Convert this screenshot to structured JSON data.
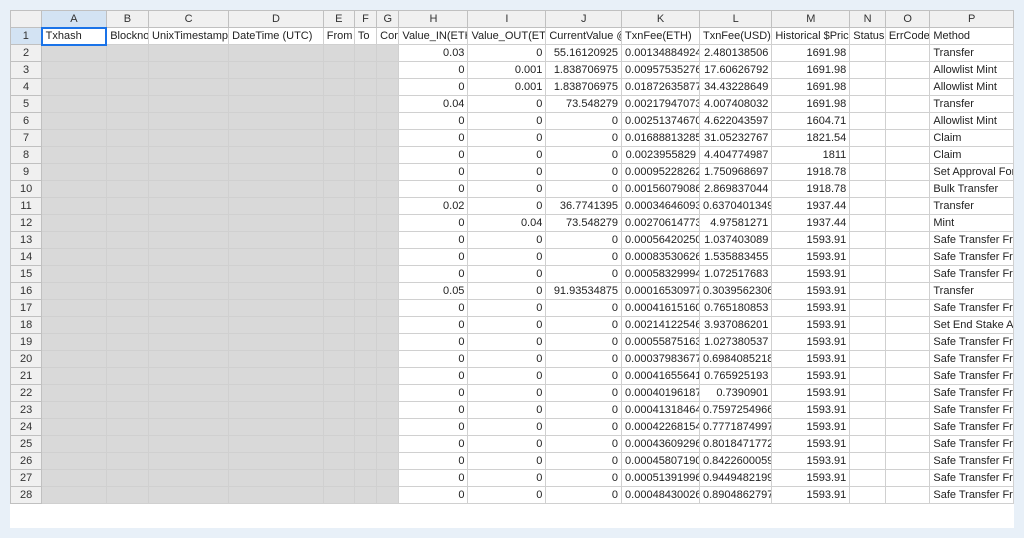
{
  "columns": [
    "A",
    "B",
    "C",
    "D",
    "E",
    "F",
    "G",
    "H",
    "I",
    "J",
    "K",
    "L",
    "M",
    "N",
    "O",
    "P"
  ],
  "headers": {
    "A": "Txhash",
    "B": "Blockno",
    "C": "UnixTimestamp",
    "D": "DateTime (UTC)",
    "E": "From",
    "F": "To",
    "G": "ContractAddress",
    "H": "Value_IN(ETH)",
    "I": "Value_OUT(ETH)",
    "J": "CurrentValue @ $",
    "K": "TxnFee(ETH)",
    "L": "TxnFee(USD)",
    "M": "Historical $Price",
    "N": "Status",
    "O": "ErrCode",
    "P": "Method"
  },
  "rows": [
    {
      "H": "0.03",
      "I": "0",
      "J": "55.16120925",
      "K": "0.00134884924",
      "L": "2.480138506",
      "M": "1691.98",
      "P": "Transfer"
    },
    {
      "H": "0",
      "I": "0.001",
      "J": "1.838706975",
      "K": "0.00957535276",
      "L": "17.60626792",
      "M": "1691.98",
      "P": "Allowlist Mint"
    },
    {
      "H": "0",
      "I": "0.001",
      "J": "1.838706975",
      "K": "0.01872635877",
      "L": "34.43228649",
      "M": "1691.98",
      "P": "Allowlist Mint"
    },
    {
      "H": "0.04",
      "I": "0",
      "J": "73.548279",
      "K": "0.00217947073",
      "L": "4.007408032",
      "M": "1691.98",
      "P": "Transfer"
    },
    {
      "H": "0",
      "I": "0",
      "J": "0",
      "K": "0.00251374670",
      "L": "4.622043597",
      "M": "1604.71",
      "P": "Allowlist Mint"
    },
    {
      "H": "0",
      "I": "0",
      "J": "0",
      "K": "0.01688813285",
      "L": "31.05232767",
      "M": "1821.54",
      "P": "Claim"
    },
    {
      "H": "0",
      "I": "0",
      "J": "0",
      "K": "0.0023955829",
      "L": "4.404774987",
      "M": "1811",
      "P": "Claim"
    },
    {
      "H": "0",
      "I": "0",
      "J": "0",
      "K": "0.00095228262",
      "L": "1.750968697",
      "M": "1918.78",
      "P": "Set Approval For All"
    },
    {
      "H": "0",
      "I": "0",
      "J": "0",
      "K": "0.00156079086",
      "L": "2.869837044",
      "M": "1918.78",
      "P": "Bulk Transfer"
    },
    {
      "H": "0.02",
      "I": "0",
      "J": "36.7741395",
      "K": "0.00034646093",
      "L": "0.6370401349",
      "M": "1937.44",
      "P": "Transfer"
    },
    {
      "H": "0",
      "I": "0.04",
      "J": "73.548279",
      "K": "0.00270614773",
      "L": "4.97581271",
      "M": "1937.44",
      "P": "Mint"
    },
    {
      "H": "0",
      "I": "0",
      "J": "0",
      "K": "0.00056420250",
      "L": "1.037403089",
      "M": "1593.91",
      "P": "Safe Transfer From"
    },
    {
      "H": "0",
      "I": "0",
      "J": "0",
      "K": "0.00083530626",
      "L": "1.535883455",
      "M": "1593.91",
      "P": "Safe Transfer From"
    },
    {
      "H": "0",
      "I": "0",
      "J": "0",
      "K": "0.00058329994",
      "L": "1.072517683",
      "M": "1593.91",
      "P": "Safe Transfer From"
    },
    {
      "H": "0.05",
      "I": "0",
      "J": "91.93534875",
      "K": "0.00016530977",
      "L": "0.3039562306",
      "M": "1593.91",
      "P": "Transfer"
    },
    {
      "H": "0",
      "I": "0",
      "J": "0",
      "K": "0.00041615160",
      "L": "0.765180853",
      "M": "1593.91",
      "P": "Safe Transfer From"
    },
    {
      "H": "0",
      "I": "0",
      "J": "0",
      "K": "0.00214122546",
      "L": "3.937086201",
      "M": "1593.91",
      "P": "Set End Stake Array"
    },
    {
      "H": "0",
      "I": "0",
      "J": "0",
      "K": "0.00055875163",
      "L": "1.027380537",
      "M": "1593.91",
      "P": "Safe Transfer From"
    },
    {
      "H": "0",
      "I": "0",
      "J": "0",
      "K": "0.00037983677",
      "L": "0.6984085218",
      "M": "1593.91",
      "P": "Safe Transfer From"
    },
    {
      "H": "0",
      "I": "0",
      "J": "0",
      "K": "0.00041655641",
      "L": "0.765925193",
      "M": "1593.91",
      "P": "Safe Transfer From"
    },
    {
      "H": "0",
      "I": "0",
      "J": "0",
      "K": "0.00040196187",
      "L": "0.7390901",
      "M": "1593.91",
      "P": "Safe Transfer From"
    },
    {
      "H": "0",
      "I": "0",
      "J": "0",
      "K": "0.00041318464",
      "L": "0.7597254966",
      "M": "1593.91",
      "P": "Safe Transfer From"
    },
    {
      "H": "0",
      "I": "0",
      "J": "0",
      "K": "0.00042268154",
      "L": "0.7771874997",
      "M": "1593.91",
      "P": "Safe Transfer From"
    },
    {
      "H": "0",
      "I": "0",
      "J": "0",
      "K": "0.00043609296",
      "L": "0.8018471772",
      "M": "1593.91",
      "P": "Safe Transfer From"
    },
    {
      "H": "0",
      "I": "0",
      "J": "0",
      "K": "0.00045807190",
      "L": "0.8422600059",
      "M": "1593.91",
      "P": "Safe Transfer From"
    },
    {
      "H": "0",
      "I": "0",
      "J": "0",
      "K": "0.00051391996",
      "L": "0.9449482199",
      "M": "1593.91",
      "P": "Safe Transfer From"
    },
    {
      "H": "0",
      "I": "0",
      "J": "0",
      "K": "0.00048430026",
      "L": "0.8904862797",
      "M": "1593.91",
      "P": "Safe Transfer From"
    }
  ]
}
